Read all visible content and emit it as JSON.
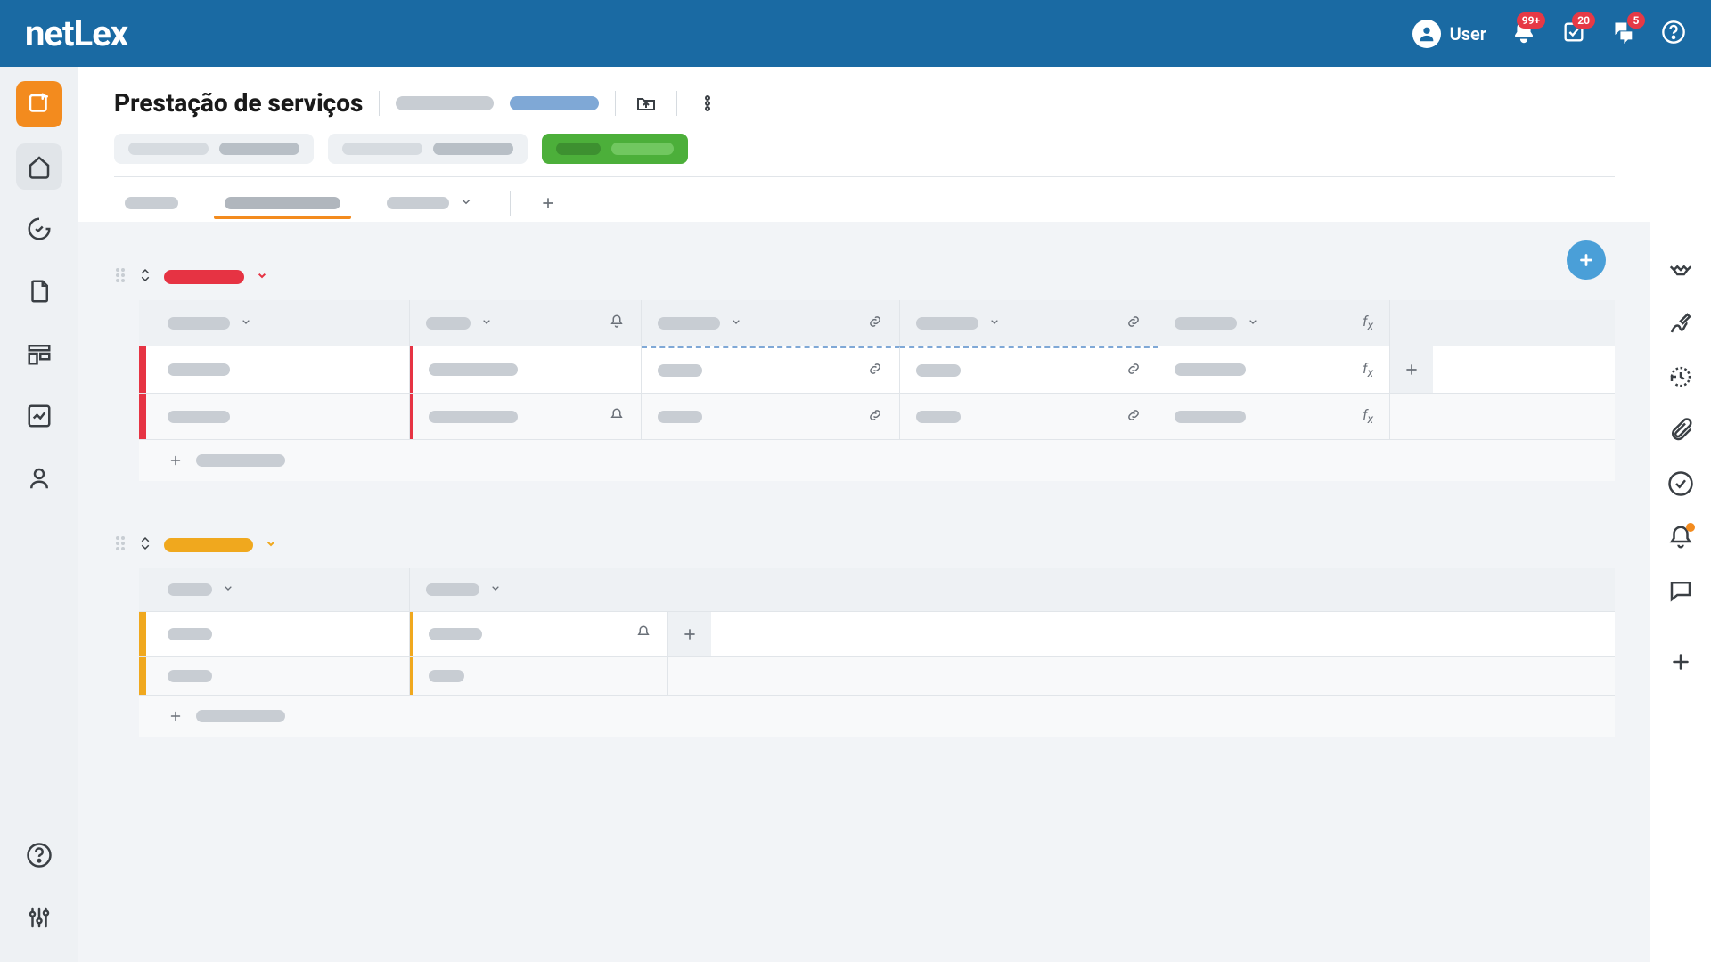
{
  "header": {
    "logo": "netLex",
    "user_label": "User",
    "badges": {
      "bell": "99+",
      "task": "20",
      "chat": "5"
    }
  },
  "page": {
    "title": "Prestação de serviços"
  },
  "group1": {
    "color": "#e63343"
  },
  "group2": {
    "color": "#f0a81e"
  }
}
